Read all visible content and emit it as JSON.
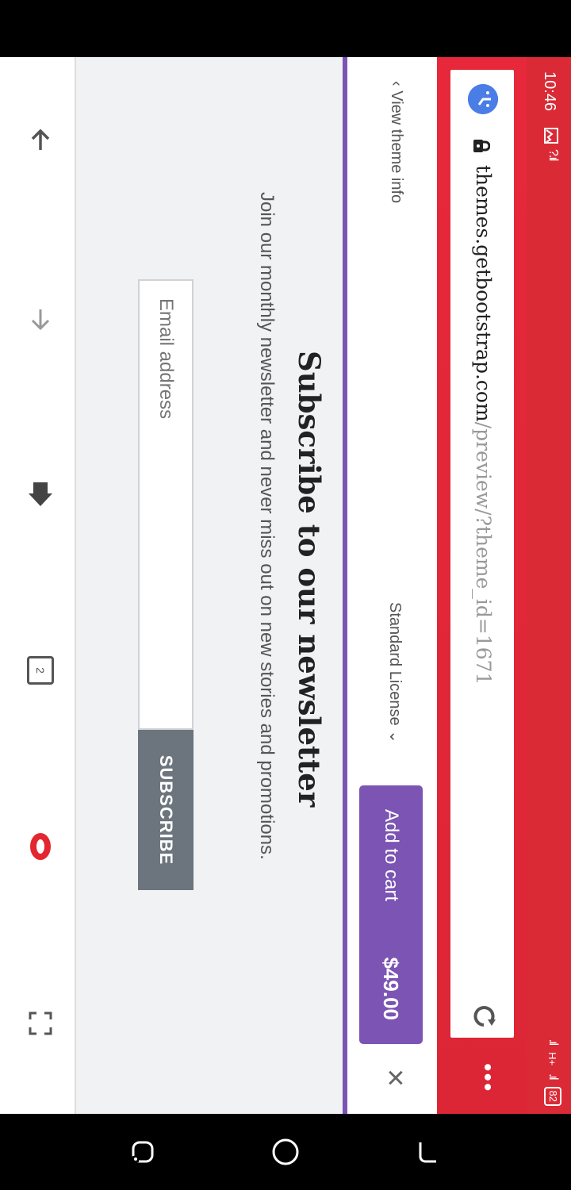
{
  "status_bar": {
    "time": "10:46",
    "battery": "82",
    "network": "H+"
  },
  "browser": {
    "url_domain": "themes.getbootstrap.com",
    "url_path": "/preview/?theme_id=1671",
    "accent_color": "#e6283a"
  },
  "header": {
    "view_theme_info": "View theme info",
    "license_label": "Standard License",
    "add_to_cart_label": "Add to cart",
    "price": "$49.00",
    "cart_color": "#7b54b4"
  },
  "newsletter": {
    "title": "Subscribe to our newsletter",
    "description": "Join our monthly newsletter and never miss out on new stories and promotions.",
    "email_placeholder": "Email address",
    "subscribe_label": "SUBSCRIBE"
  },
  "bottom_nav": {
    "tab_count": "2"
  }
}
